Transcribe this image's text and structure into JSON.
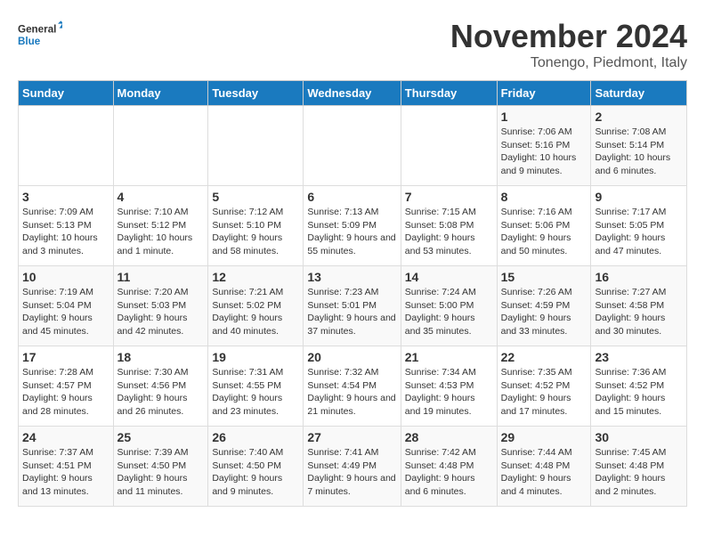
{
  "logo": {
    "line1": "General",
    "line2": "Blue"
  },
  "header": {
    "month": "November 2024",
    "location": "Tonengo, Piedmont, Italy"
  },
  "weekdays": [
    "Sunday",
    "Monday",
    "Tuesday",
    "Wednesday",
    "Thursday",
    "Friday",
    "Saturday"
  ],
  "weeks": [
    [
      {
        "day": "",
        "info": ""
      },
      {
        "day": "",
        "info": ""
      },
      {
        "day": "",
        "info": ""
      },
      {
        "day": "",
        "info": ""
      },
      {
        "day": "",
        "info": ""
      },
      {
        "day": "1",
        "info": "Sunrise: 7:06 AM\nSunset: 5:16 PM\nDaylight: 10 hours and 9 minutes."
      },
      {
        "day": "2",
        "info": "Sunrise: 7:08 AM\nSunset: 5:14 PM\nDaylight: 10 hours and 6 minutes."
      }
    ],
    [
      {
        "day": "3",
        "info": "Sunrise: 7:09 AM\nSunset: 5:13 PM\nDaylight: 10 hours and 3 minutes."
      },
      {
        "day": "4",
        "info": "Sunrise: 7:10 AM\nSunset: 5:12 PM\nDaylight: 10 hours and 1 minute."
      },
      {
        "day": "5",
        "info": "Sunrise: 7:12 AM\nSunset: 5:10 PM\nDaylight: 9 hours and 58 minutes."
      },
      {
        "day": "6",
        "info": "Sunrise: 7:13 AM\nSunset: 5:09 PM\nDaylight: 9 hours and 55 minutes."
      },
      {
        "day": "7",
        "info": "Sunrise: 7:15 AM\nSunset: 5:08 PM\nDaylight: 9 hours and 53 minutes."
      },
      {
        "day": "8",
        "info": "Sunrise: 7:16 AM\nSunset: 5:06 PM\nDaylight: 9 hours and 50 minutes."
      },
      {
        "day": "9",
        "info": "Sunrise: 7:17 AM\nSunset: 5:05 PM\nDaylight: 9 hours and 47 minutes."
      }
    ],
    [
      {
        "day": "10",
        "info": "Sunrise: 7:19 AM\nSunset: 5:04 PM\nDaylight: 9 hours and 45 minutes."
      },
      {
        "day": "11",
        "info": "Sunrise: 7:20 AM\nSunset: 5:03 PM\nDaylight: 9 hours and 42 minutes."
      },
      {
        "day": "12",
        "info": "Sunrise: 7:21 AM\nSunset: 5:02 PM\nDaylight: 9 hours and 40 minutes."
      },
      {
        "day": "13",
        "info": "Sunrise: 7:23 AM\nSunset: 5:01 PM\nDaylight: 9 hours and 37 minutes."
      },
      {
        "day": "14",
        "info": "Sunrise: 7:24 AM\nSunset: 5:00 PM\nDaylight: 9 hours and 35 minutes."
      },
      {
        "day": "15",
        "info": "Sunrise: 7:26 AM\nSunset: 4:59 PM\nDaylight: 9 hours and 33 minutes."
      },
      {
        "day": "16",
        "info": "Sunrise: 7:27 AM\nSunset: 4:58 PM\nDaylight: 9 hours and 30 minutes."
      }
    ],
    [
      {
        "day": "17",
        "info": "Sunrise: 7:28 AM\nSunset: 4:57 PM\nDaylight: 9 hours and 28 minutes."
      },
      {
        "day": "18",
        "info": "Sunrise: 7:30 AM\nSunset: 4:56 PM\nDaylight: 9 hours and 26 minutes."
      },
      {
        "day": "19",
        "info": "Sunrise: 7:31 AM\nSunset: 4:55 PM\nDaylight: 9 hours and 23 minutes."
      },
      {
        "day": "20",
        "info": "Sunrise: 7:32 AM\nSunset: 4:54 PM\nDaylight: 9 hours and 21 minutes."
      },
      {
        "day": "21",
        "info": "Sunrise: 7:34 AM\nSunset: 4:53 PM\nDaylight: 9 hours and 19 minutes."
      },
      {
        "day": "22",
        "info": "Sunrise: 7:35 AM\nSunset: 4:52 PM\nDaylight: 9 hours and 17 minutes."
      },
      {
        "day": "23",
        "info": "Sunrise: 7:36 AM\nSunset: 4:52 PM\nDaylight: 9 hours and 15 minutes."
      }
    ],
    [
      {
        "day": "24",
        "info": "Sunrise: 7:37 AM\nSunset: 4:51 PM\nDaylight: 9 hours and 13 minutes."
      },
      {
        "day": "25",
        "info": "Sunrise: 7:39 AM\nSunset: 4:50 PM\nDaylight: 9 hours and 11 minutes."
      },
      {
        "day": "26",
        "info": "Sunrise: 7:40 AM\nSunset: 4:50 PM\nDaylight: 9 hours and 9 minutes."
      },
      {
        "day": "27",
        "info": "Sunrise: 7:41 AM\nSunset: 4:49 PM\nDaylight: 9 hours and 7 minutes."
      },
      {
        "day": "28",
        "info": "Sunrise: 7:42 AM\nSunset: 4:48 PM\nDaylight: 9 hours and 6 minutes."
      },
      {
        "day": "29",
        "info": "Sunrise: 7:44 AM\nSunset: 4:48 PM\nDaylight: 9 hours and 4 minutes."
      },
      {
        "day": "30",
        "info": "Sunrise: 7:45 AM\nSunset: 4:48 PM\nDaylight: 9 hours and 2 minutes."
      }
    ]
  ]
}
